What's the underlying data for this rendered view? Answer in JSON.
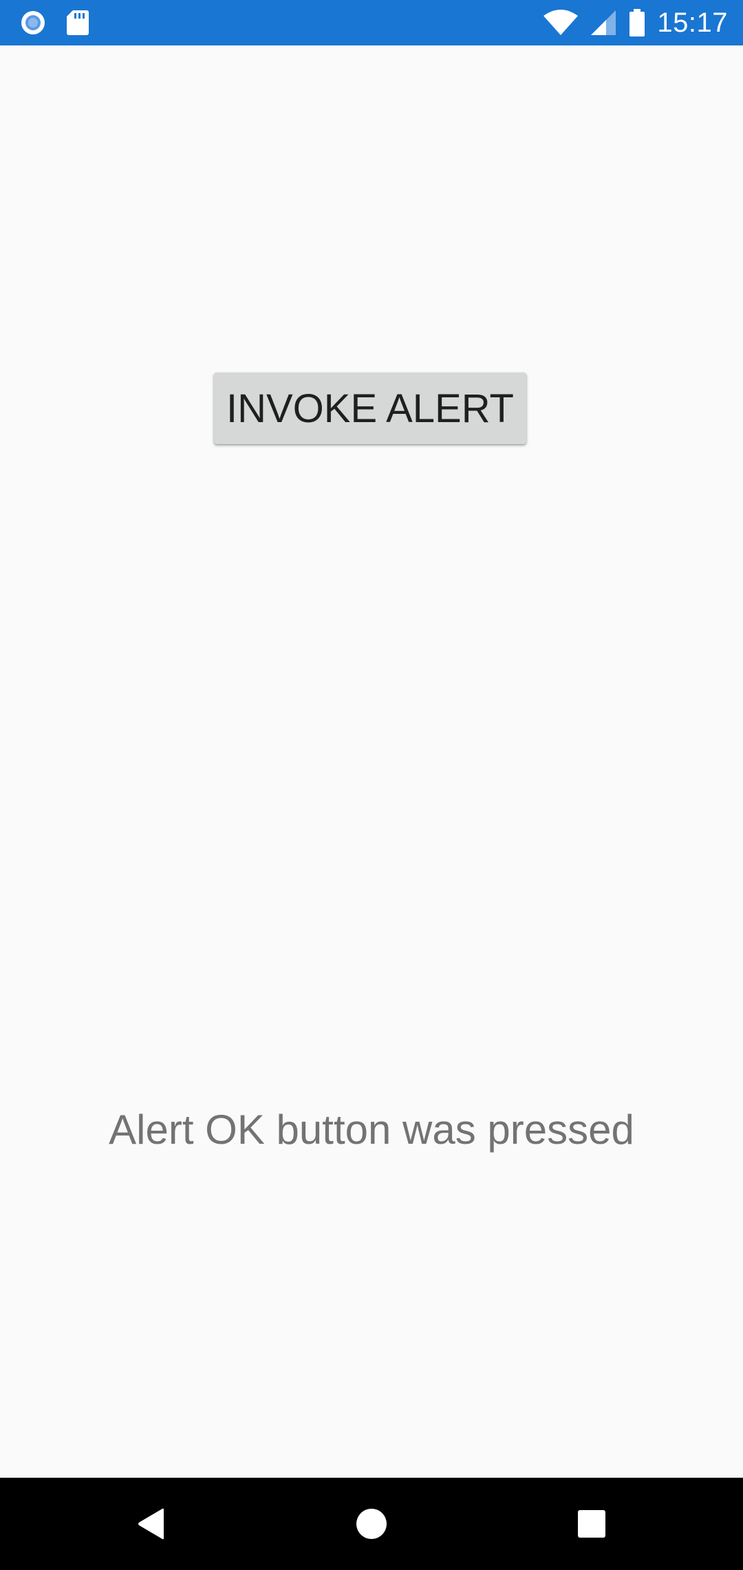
{
  "status_bar": {
    "time": "15:17",
    "left_icons": [
      "record-icon",
      "sd-card-icon"
    ],
    "right_icons": [
      "wifi-icon",
      "cell-signal-icon",
      "battery-icon"
    ],
    "background_color": "#1976d2"
  },
  "main": {
    "invoke_button_label": "INVOKE ALERT",
    "result_message": "Alert OK button was pressed"
  },
  "nav_bar": {
    "buttons": [
      "back-icon",
      "home-icon",
      "recents-icon"
    ]
  }
}
